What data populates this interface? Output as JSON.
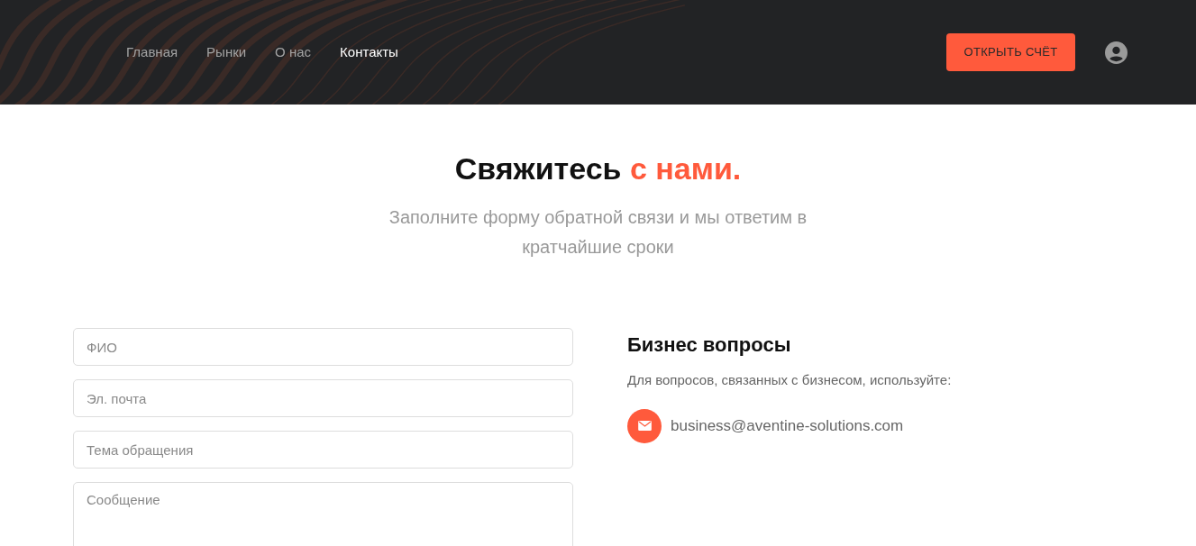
{
  "nav": {
    "items": [
      {
        "label": "Главная",
        "selected": false
      },
      {
        "label": "Рынки",
        "selected": false
      },
      {
        "label": "О нас",
        "selected": false
      },
      {
        "label": "Контакты",
        "selected": true
      }
    ],
    "cta": "ОТКРЫТЬ СЧЁТ"
  },
  "hero": {
    "title": "Свяжитесь",
    "title_accent": "с нами.",
    "subtitle": "Заполните форму обратной связи и мы ответим в кратчайшие сроки"
  },
  "form": {
    "fields": [
      {
        "kind": "input",
        "placeholder": "ФИО"
      },
      {
        "kind": "input",
        "placeholder": "Эл. почта"
      },
      {
        "kind": "input",
        "placeholder": "Тема обращения"
      },
      {
        "kind": "textarea",
        "placeholder": "Сообщение"
      }
    ]
  },
  "contact": {
    "title": "Бизнес вопросы",
    "text": "Для вопросов, связанных с бизнесом, используйте:",
    "email": "business@aventine-solutions.com"
  }
}
